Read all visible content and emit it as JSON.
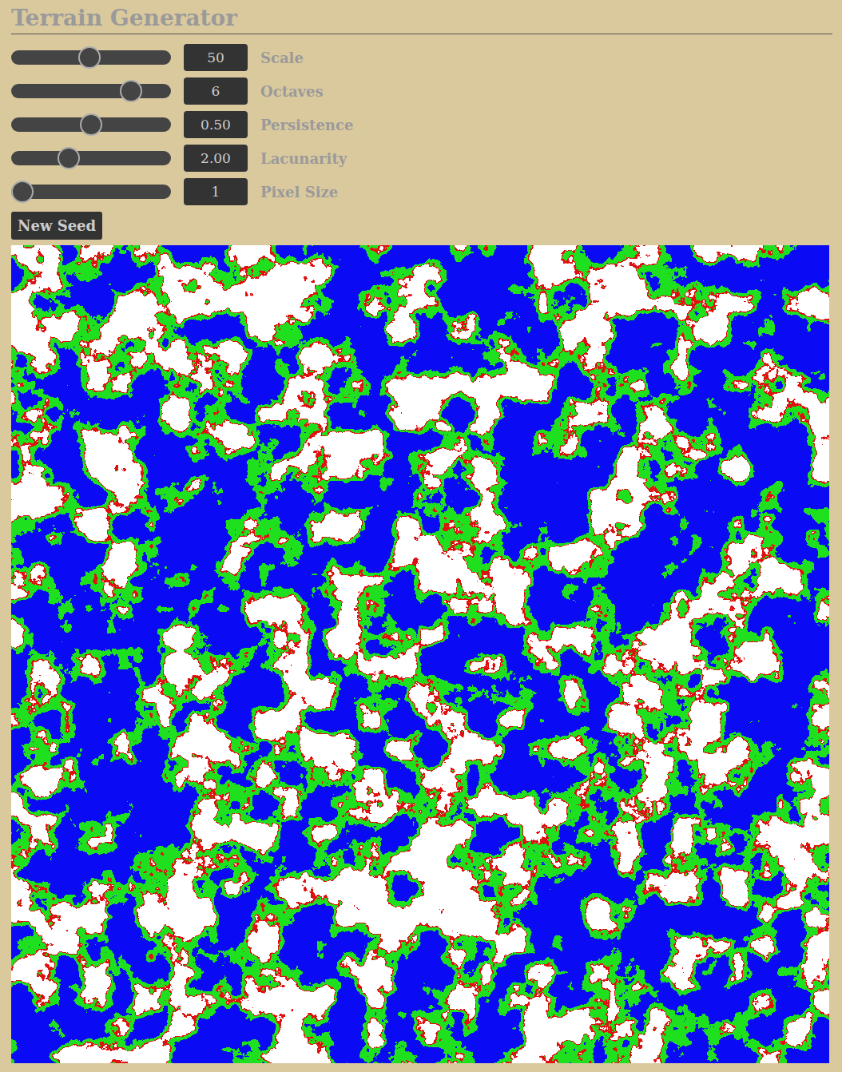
{
  "title": "Terrain Generator",
  "controls": [
    {
      "label": "Scale",
      "value": "50",
      "level": 0.49
    },
    {
      "label": "Octaves",
      "value": "6",
      "level": 0.79
    },
    {
      "label": "Persistence",
      "value": "0.50",
      "level": 0.5
    },
    {
      "label": "Lacunarity",
      "value": "2.00",
      "level": 0.34
    },
    {
      "label": "Pixel Size",
      "value": "1",
      "level": 0.0
    }
  ],
  "button": "New Seed",
  "map": {
    "bands": [
      {
        "color": "#0a0af5"
      },
      {
        "color": "#1fe01f"
      },
      {
        "color": "#e01010"
      },
      {
        "color": "#ffffff"
      }
    ]
  }
}
